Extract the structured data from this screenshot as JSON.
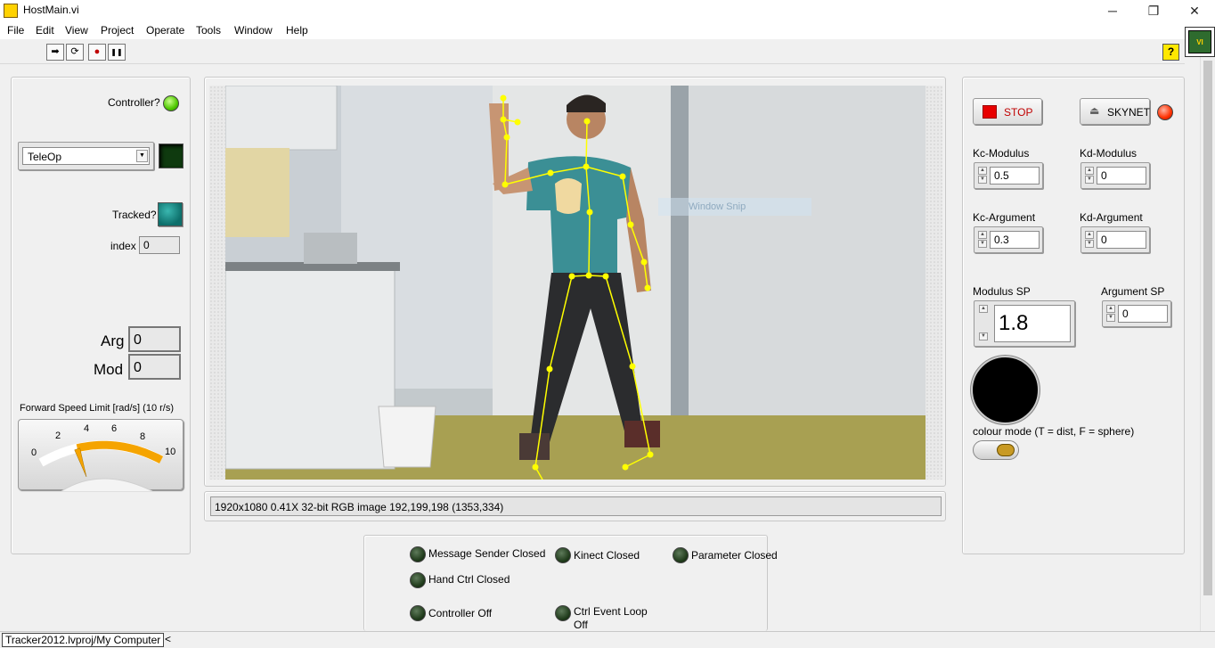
{
  "window": {
    "title": "HostMain.vi",
    "minimize": "─",
    "maximize": "❐",
    "close": "✕"
  },
  "menu": [
    "File",
    "Edit",
    "View",
    "Project",
    "Operate",
    "Tools",
    "Window",
    "Help"
  ],
  "toolbar": {
    "run": "➡",
    "run_continuous": "⟳",
    "abort": "●",
    "pause": "❚❚",
    "help": "?"
  },
  "left": {
    "controller_label": "Controller?",
    "mode_value": "TeleOp",
    "tracked_label": "Tracked?",
    "index_label": "index",
    "index_value": "0",
    "arg_label": "Arg",
    "arg_value": "0",
    "mod_label": "Mod",
    "mod_value": "0",
    "gauge_title": "Forward Speed Limit [rad/s] (10 r/s)",
    "gauge_ticks": [
      "0",
      "2",
      "4",
      "6",
      "8",
      "10"
    ],
    "gauge_value": 3
  },
  "image": {
    "status": "1920x1080 0.41X 32-bit RGB image 192,199,198    (1353,334)",
    "overlay_text": "Window Snip"
  },
  "right": {
    "stop_label": "STOP",
    "skynet_label": "SKYNET",
    "kc_modulus_label": "Kc-Modulus",
    "kc_modulus_value": "0.5",
    "kd_modulus_label": "Kd-Modulus",
    "kd_modulus_value": "0",
    "kc_argument_label": "Kc-Argument",
    "kc_argument_value": "0.3",
    "kd_argument_label": "Kd-Argument",
    "kd_argument_value": "0",
    "modulus_sp_label": "Modulus SP",
    "modulus_sp_value": "1.8",
    "argument_sp_label": "Argument SP",
    "argument_sp_value": "0",
    "colour_mode_label": "colour mode (T = dist, F = sphere)"
  },
  "status_leds": {
    "message_sender": "Message Sender Closed",
    "kinect": "Kinect Closed",
    "parameter": "Parameter Closed",
    "hand_ctrl": "Hand Ctrl Closed",
    "controller": "Controller Off",
    "ctrl_event_loop_1": "Ctrl Event Loop",
    "ctrl_event_loop_2": "Off"
  },
  "footer": {
    "project_path": "Tracker2012.lvproj/My Computer",
    "scroll_left": "<"
  },
  "colors": {
    "led_on_green": "#4ec800",
    "led_on_red": "#ff3000",
    "led_off": "#1f3a1a",
    "stop_red": "#e80000",
    "gauge_fill": "#f5a400"
  }
}
